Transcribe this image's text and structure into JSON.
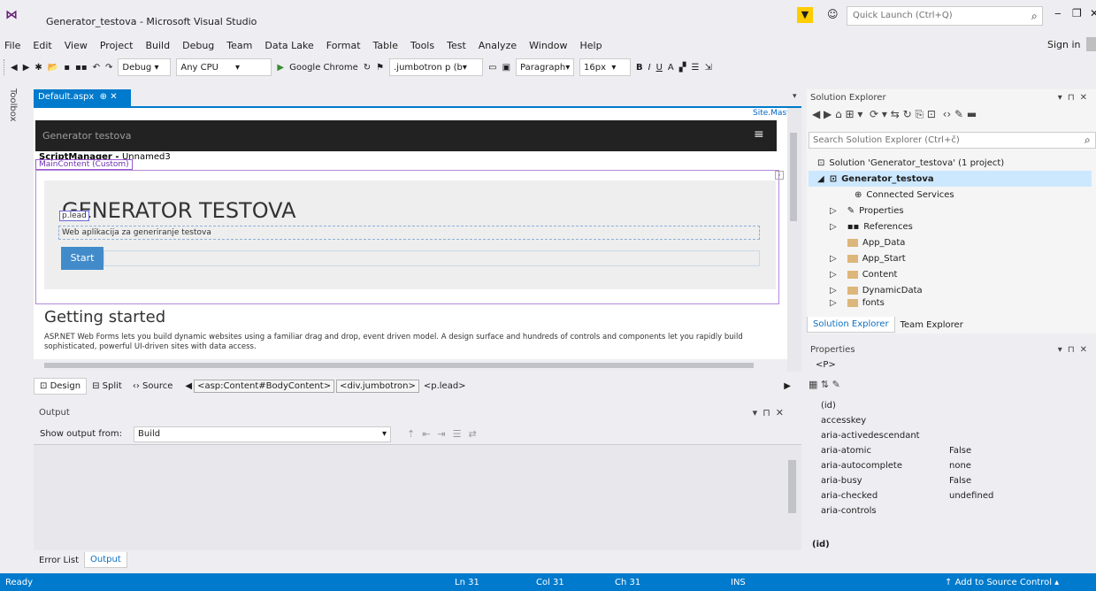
{
  "window": {
    "title": "Generator_testova - Microsoft Visual Studio",
    "quick_launch_placeholder": "Quick Launch (Ctrl+Q)"
  },
  "menu": [
    "File",
    "Edit",
    "View",
    "Project",
    "Build",
    "Debug",
    "Team",
    "Data Lake",
    "Format",
    "Table",
    "Tools",
    "Test",
    "Analyze",
    "Window",
    "Help"
  ],
  "sign_in": "Sign in",
  "toolbar": {
    "config": "Debug",
    "platform": "Any CPU",
    "run_target": "Google Chrome",
    "css_selector": ".jumbotron p (b",
    "block_format": "Paragraph",
    "font_size": "16px",
    "bold": "B",
    "italic": "I",
    "underline": "U"
  },
  "toolbox_label": "Toolbox",
  "document": {
    "tab_label": "Default.aspx",
    "site_master": "Site.Master",
    "navbar_brand": "Generator testova",
    "script_manager": "ScriptManager - ",
    "script_manager_suffix": "Unnamed3",
    "main_content_label": "MainContent (Custom)",
    "heading": "GENERATOR TESTOVA",
    "p_lead_label": "p.lead",
    "lead_text": "Web aplikacija za generiranje testova",
    "start_button": "Start",
    "getting_started_title": "Getting started",
    "getting_started_body": "ASP.NET Web Forms lets you build dynamic websites using a familiar drag and drop, event driven model. A design surface and hundreds of controls and components let you rapidly build sophisticated, powerful UI-driven sites with data access."
  },
  "design_bar": {
    "design": "Design",
    "split": "Split",
    "source": "Source",
    "crumbs": [
      "<asp:Content#BodyContent>",
      "<div.jumbotron>",
      "<p.lead>"
    ]
  },
  "output": {
    "title": "Output",
    "show_from_label": "Show output from:",
    "show_from_value": "Build"
  },
  "bottom_tabs": [
    "Error List",
    "Output"
  ],
  "solution_explorer": {
    "title": "Solution Explorer",
    "search_placeholder": "Search Solution Explorer (Ctrl+č)",
    "solution": "Solution 'Generator_testova' (1 project)",
    "project": "Generator_testova",
    "items": [
      "Connected Services",
      "Properties",
      "References",
      "App_Data",
      "App_Start",
      "Content",
      "DynamicData",
      "fonts"
    ],
    "tabs": [
      "Solution Explorer",
      "Team Explorer"
    ]
  },
  "properties": {
    "title": "Properties",
    "element": "<P>",
    "rows": [
      {
        "name": "(id)",
        "value": ""
      },
      {
        "name": "accesskey",
        "value": ""
      },
      {
        "name": "aria-activedescendant",
        "value": ""
      },
      {
        "name": "aria-atomic",
        "value": "False"
      },
      {
        "name": "aria-autocomplete",
        "value": "none"
      },
      {
        "name": "aria-busy",
        "value": "False"
      },
      {
        "name": "aria-checked",
        "value": "undefined"
      },
      {
        "name": "aria-controls",
        "value": ""
      }
    ],
    "description": "(id)"
  },
  "status": {
    "ready": "Ready",
    "ln": "Ln 31",
    "col": "Col 31",
    "ch": "Ch 31",
    "ins": "INS",
    "source_control": "Add to Source Control"
  },
  "colors": {
    "accent": "#007acc",
    "bootstrap_primary": "#428bca",
    "navbar": "#222222"
  }
}
